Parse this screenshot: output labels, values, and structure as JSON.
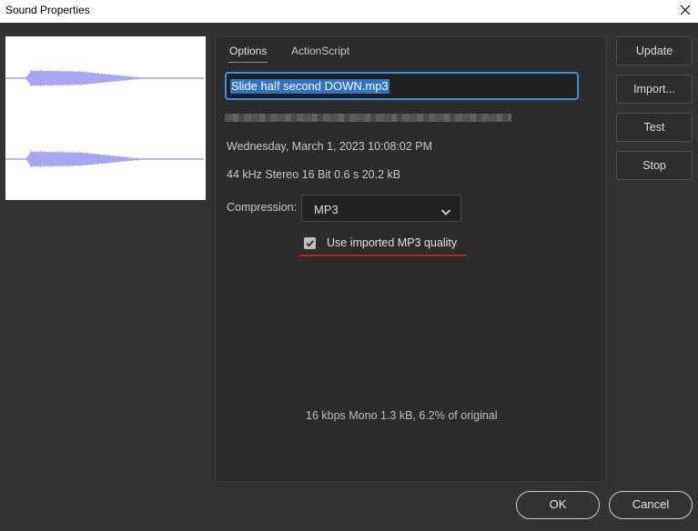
{
  "window": {
    "title": "Sound Properties"
  },
  "tabs": [
    {
      "label": "Options",
      "active": true
    },
    {
      "label": "ActionScript",
      "active": false
    }
  ],
  "file": {
    "name": "Slide half second DOWN.mp3",
    "date": "Wednesday, March 1, 2023  10:08:02 PM",
    "format": "44 kHz Stereo 16 Bit 0.6 s 20.2 kB"
  },
  "compression": {
    "label": "Compression:",
    "value": "MP3"
  },
  "mp3_quality": {
    "label": "Use imported MP3 quality",
    "checked": true
  },
  "summary": "16 kbps  Mono 1.3 kB, 6.2% of original",
  "side_buttons": {
    "update": "Update",
    "import": "Import...",
    "test": "Test",
    "stop": "Stop"
  },
  "footer": {
    "ok": "OK",
    "cancel": "Cancel"
  },
  "colors": {
    "waveform": "#a6a6f2",
    "accent": "#3a8ee6",
    "annotation": "#c8212a"
  }
}
